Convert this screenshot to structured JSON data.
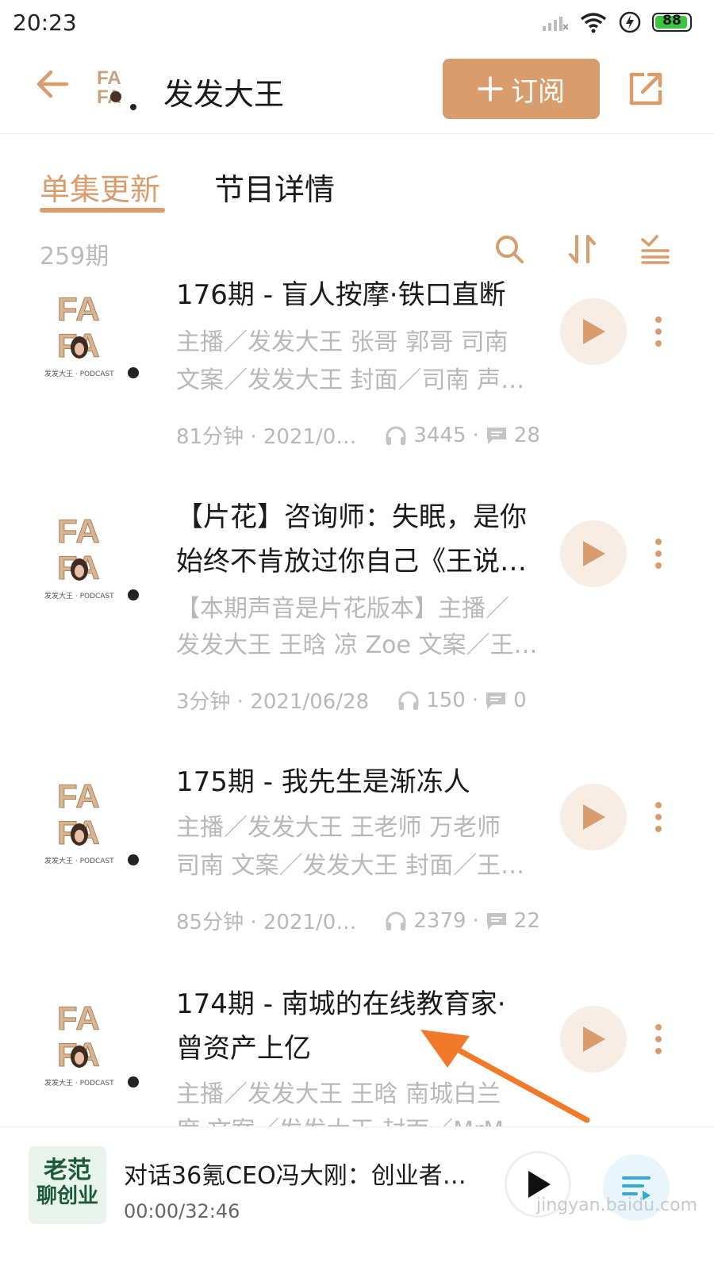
{
  "status": {
    "time": "20:23",
    "battery": "88"
  },
  "header": {
    "title": "发发大王",
    "subscribe_label": "订阅"
  },
  "tabs": [
    {
      "label": "单集更新",
      "active": true
    },
    {
      "label": "节目详情",
      "active": false
    }
  ],
  "list": {
    "count": "259期"
  },
  "episodes": [
    {
      "title_lines": [
        "176期 - 盲人按摩·铁口直断"
      ],
      "desc_lines": [
        "主播／发发大王 张哥 郭哥 司南",
        "文案／发发大王 封面／司南 声…"
      ],
      "duration_date": "81分钟 · 2021/0…",
      "plays": "3445",
      "comments": "28"
    },
    {
      "title_lines": [
        "【片花】咨询师：失眠，是你",
        "始终不肯放过你自己《王说…"
      ],
      "desc_lines": [
        "【本期声音是片花版本】主播／",
        "发发大王 王晗 凉 Zoe 文案／王…"
      ],
      "duration_date": "3分钟 · 2021/06/28",
      "plays": "150",
      "comments": "0"
    },
    {
      "title_lines": [
        "175期 - 我先生是渐冻人"
      ],
      "desc_lines": [
        "主播／发发大王 王老师 万老师",
        "司南 文案／发发大王 封面／王…"
      ],
      "duration_date": "85分钟 · 2021/0…",
      "plays": "2379",
      "comments": "22"
    },
    {
      "title_lines": [
        "174期 - 南城的在线教育家·",
        "曾资产上亿"
      ],
      "desc_lines": [
        "主播／发发大王 王晗 南城白兰",
        "度 文案／发发大王 封面／MrM…"
      ]
    }
  ],
  "player": {
    "title": "对话36氪CEO冯大刚：创业者…",
    "time": "00:00/32:46",
    "cover_text": [
      "老范",
      "聊创业"
    ]
  },
  "watermark": "jingyan.baidu.com",
  "colors": {
    "accent": "#d99c6c",
    "play_bg": "#f8ede5",
    "annotation_arrow": "#f07a2a"
  }
}
